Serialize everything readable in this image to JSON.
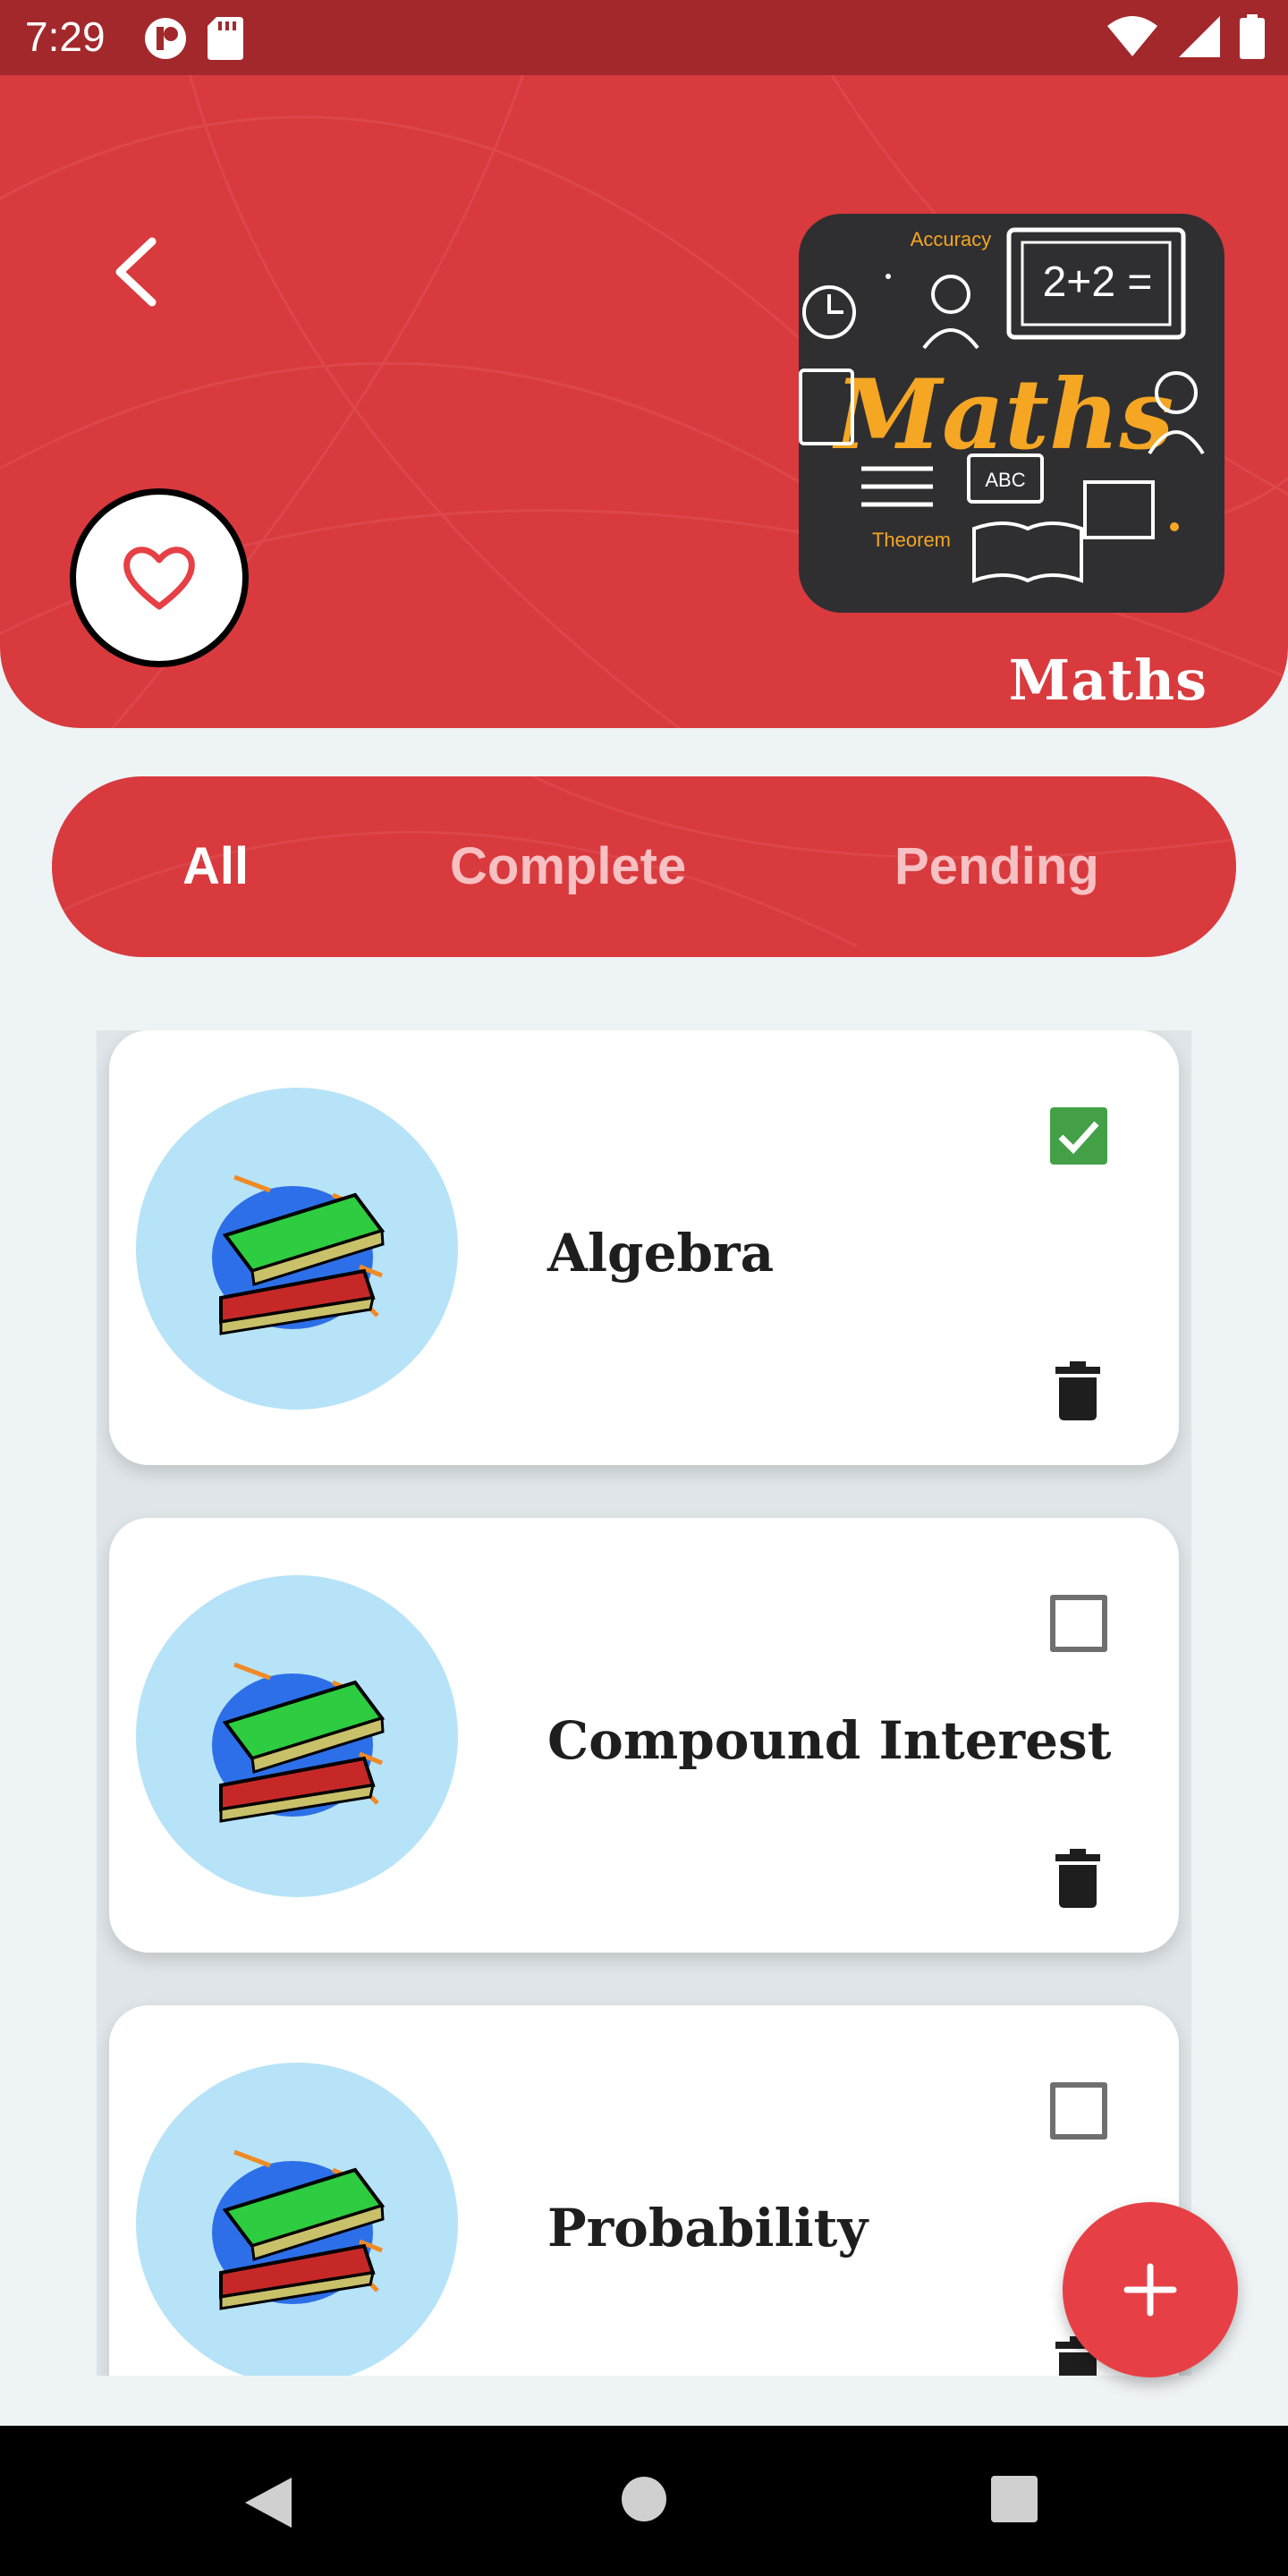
{
  "status_bar": {
    "time": "7:29"
  },
  "header": {
    "subject_title": "Maths"
  },
  "subject_image": {
    "title": "Maths",
    "labels": [
      "Accuracy",
      "2+2 =",
      "ABC",
      "Theorem"
    ]
  },
  "tabs": [
    {
      "label": "All",
      "active": true
    },
    {
      "label": "Complete",
      "active": false
    },
    {
      "label": "Pending",
      "active": false
    }
  ],
  "topics": [
    {
      "title": "Algebra",
      "checked": true
    },
    {
      "title": "Compound Interest",
      "checked": false
    },
    {
      "title": "Probability",
      "checked": false
    }
  ],
  "colors": {
    "primary_red": "#d83a3e",
    "status_bar": "#a3282c",
    "check_green": "#43a047",
    "avatar_bg": "#b7e3f8",
    "fab": "#e64046"
  },
  "icons": {
    "back": "arrow-back-icon",
    "favorite": "heart-outline-icon",
    "delete": "trash-icon",
    "add": "plus-icon"
  }
}
